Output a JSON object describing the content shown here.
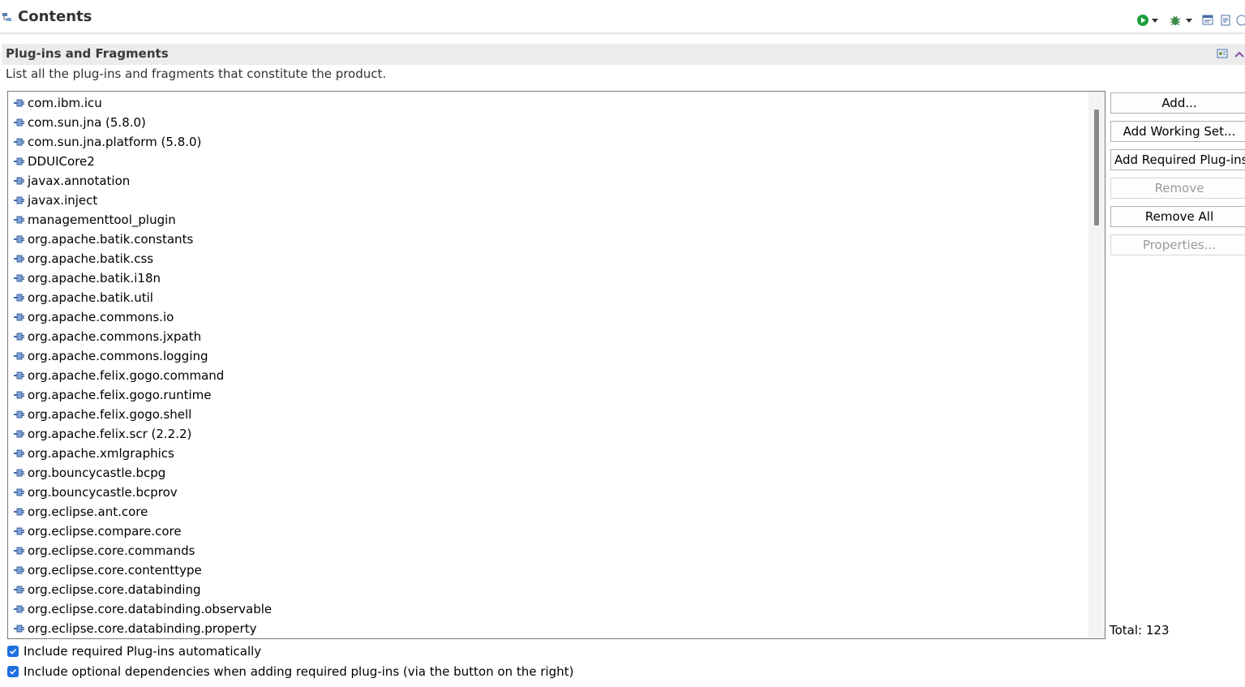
{
  "header": {
    "title": "Contents",
    "icon": "contents-icon"
  },
  "toolbar": {
    "icons": [
      "run-icon",
      "dropdown-arrow-icon",
      "debug-icon",
      "dropdown-arrow-icon",
      "export-icon",
      "doc-icon",
      "help-icon"
    ]
  },
  "section": {
    "title": "Plug-ins and Fragments",
    "description": "List all the plug-ins and fragments that constitute the product."
  },
  "plugins": [
    "com.ibm.icu",
    "com.sun.jna (5.8.0)",
    "com.sun.jna.platform (5.8.0)",
    "DDUICore2",
    "javax.annotation",
    "javax.inject",
    "managementtool_plugin",
    "org.apache.batik.constants",
    "org.apache.batik.css",
    "org.apache.batik.i18n",
    "org.apache.batik.util",
    "org.apache.commons.io",
    "org.apache.commons.jxpath",
    "org.apache.commons.logging",
    "org.apache.felix.gogo.command",
    "org.apache.felix.gogo.runtime",
    "org.apache.felix.gogo.shell",
    "org.apache.felix.scr (2.2.2)",
    "org.apache.xmlgraphics",
    "org.bouncycastle.bcpg",
    "org.bouncycastle.bcprov",
    "org.eclipse.ant.core",
    "org.eclipse.compare.core",
    "org.eclipse.core.commands",
    "org.eclipse.core.contenttype",
    "org.eclipse.core.databinding",
    "org.eclipse.core.databinding.observable",
    "org.eclipse.core.databinding.property"
  ],
  "buttons": {
    "add": "Add...",
    "add_working_set": "Add Working Set...",
    "add_required": "Add Required Plug-ins",
    "remove": "Remove",
    "remove_all": "Remove All",
    "properties": "Properties..."
  },
  "total": "Total: 123",
  "options": {
    "include_required": "Include required Plug-ins automatically",
    "include_optional": "Include optional dependencies when adding required plug-ins (via the button on the right)"
  },
  "colors": {
    "checkbox": "#1f6fe0",
    "section_bar": "#ececec",
    "accent_green": "#1e9e3e"
  }
}
